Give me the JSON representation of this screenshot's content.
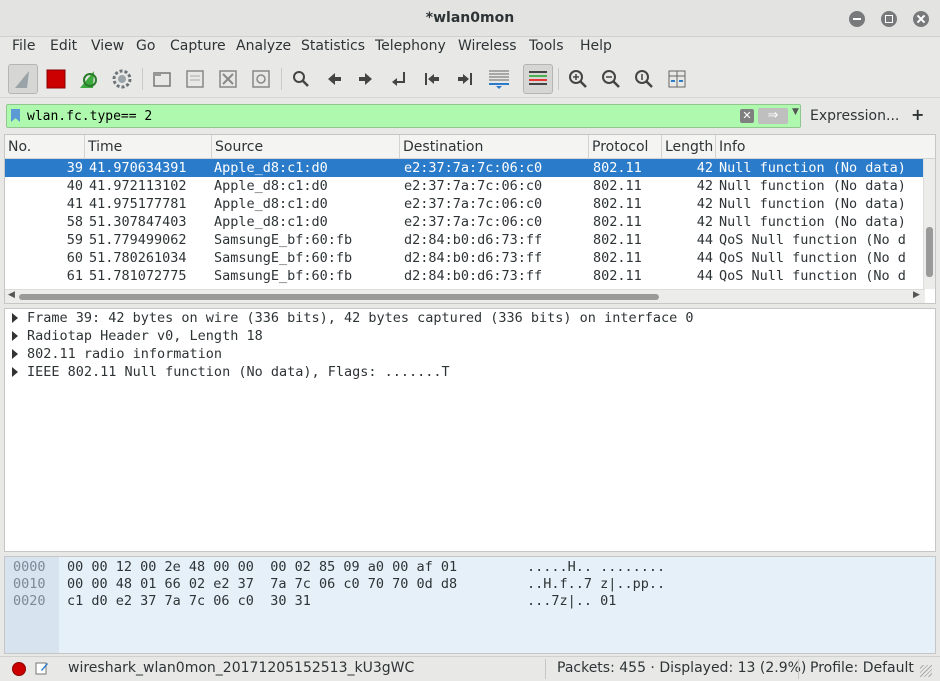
{
  "window": {
    "title": "*wlan0mon"
  },
  "menu": [
    "File",
    "Edit",
    "View",
    "Go",
    "Capture",
    "Analyze",
    "Statistics",
    "Telephony",
    "Wireless",
    "Tools",
    "Help"
  ],
  "toolbar": {
    "icons": [
      "shark-fin-start-icon",
      "stop-capture-icon",
      "restart-capture-icon",
      "capture-options-gear-icon",
      "open-file-icon",
      "save-file-icon",
      "close-file-icon",
      "reload-file-icon",
      "find-packet-icon",
      "go-back-icon",
      "go-forward-icon",
      "go-to-packet-icon",
      "go-first-icon",
      "go-last-icon",
      "autoscroll-icon",
      "colorize-icon",
      "zoom-in-icon",
      "zoom-out-icon",
      "zoom-reset-icon",
      "resize-columns-icon"
    ]
  },
  "filter": {
    "value": "wlan.fc.type== 2",
    "expression_label": "Expression...",
    "plus_label": "+"
  },
  "packet_list": {
    "columns": [
      "No.",
      "Time",
      "Source",
      "Destination",
      "Protocol",
      "Length",
      "Info"
    ],
    "rows": [
      {
        "no": "39",
        "time": "41.970634391",
        "source": "Apple_d8:c1:d0",
        "destination": "e2:37:7a:7c:06:c0",
        "protocol": "802.11",
        "length": "42",
        "info": "Null function (No data)"
      },
      {
        "no": "40",
        "time": "41.972113102",
        "source": "Apple_d8:c1:d0",
        "destination": "e2:37:7a:7c:06:c0",
        "protocol": "802.11",
        "length": "42",
        "info": "Null function (No data)"
      },
      {
        "no": "41",
        "time": "41.975177781",
        "source": "Apple_d8:c1:d0",
        "destination": "e2:37:7a:7c:06:c0",
        "protocol": "802.11",
        "length": "42",
        "info": "Null function (No data)"
      },
      {
        "no": "58",
        "time": "51.307847403",
        "source": "Apple_d8:c1:d0",
        "destination": "e2:37:7a:7c:06:c0",
        "protocol": "802.11",
        "length": "42",
        "info": "Null function (No data)"
      },
      {
        "no": "59",
        "time": "51.779499062",
        "source": "SamsungE_bf:60:fb",
        "destination": "d2:84:b0:d6:73:ff",
        "protocol": "802.11",
        "length": "44",
        "info": "QoS Null function (No d"
      },
      {
        "no": "60",
        "time": "51.780261034",
        "source": "SamsungE_bf:60:fb",
        "destination": "d2:84:b0:d6:73:ff",
        "protocol": "802.11",
        "length": "44",
        "info": "QoS Null function (No d"
      },
      {
        "no": "61",
        "time": "51.781072775",
        "source": "SamsungE_bf:60:fb",
        "destination": "d2:84:b0:d6:73:ff",
        "protocol": "802.11",
        "length": "44",
        "info": "QoS Null function (No d"
      }
    ]
  },
  "details": [
    "Frame 39: 42 bytes on wire (336 bits), 42 bytes captured (336 bits) on interface 0",
    "Radiotap Header v0, Length 18",
    "802.11 radio information",
    "IEEE 802.11 Null function (No data), Flags: .......T"
  ],
  "bytes": [
    {
      "offset": "0000",
      "hex": "00 00 12 00 2e 48 00 00  00 02 85 09 a0 00 af 01",
      "ascii": ".....H.. ........"
    },
    {
      "offset": "0010",
      "hex": "00 00 48 01 66 02 e2 37  7a 7c 06 c0 70 70 0d d8",
      "ascii": "..H.f..7 z|..pp.."
    },
    {
      "offset": "0020",
      "hex": "c1 d0 e2 37 7a 7c 06 c0  30 31",
      "ascii": "...7z|.. 01"
    }
  ],
  "status": {
    "file": "wireshark_wlan0mon_20171205152513_kU3gWC",
    "packets": "Packets: 455 · Displayed: 13 (2.9%)",
    "profile": "Profile: Default"
  },
  "colors": {
    "selection": "#2a7bc9",
    "filter_ok": "#aff9af",
    "stop": "#cc0000"
  }
}
